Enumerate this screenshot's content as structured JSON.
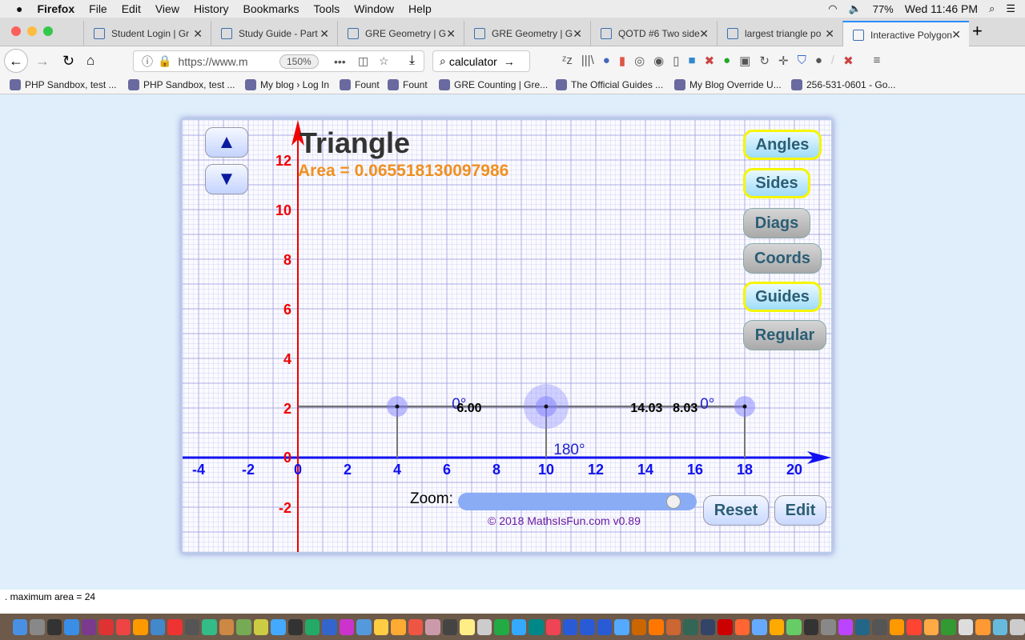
{
  "menubar": {
    "app": "Firefox",
    "items": [
      "File",
      "Edit",
      "View",
      "History",
      "Bookmarks",
      "Tools",
      "Window",
      "Help"
    ],
    "battery": "77%",
    "clock": "Wed 11:46 PM"
  },
  "tabs": [
    {
      "label": "Student Login | Gr"
    },
    {
      "label": "Study Guide - Part"
    },
    {
      "label": "GRE Geometry | G"
    },
    {
      "label": "GRE Geometry | G"
    },
    {
      "label": "QOTD #6 Two side"
    },
    {
      "label": "largest triangle po"
    },
    {
      "label": "Interactive Polygon",
      "active": true
    }
  ],
  "nav": {
    "url": "https://www.m",
    "zoom": "150%",
    "search": "calculator"
  },
  "bookmarks": [
    "PHP Sandbox, test ...",
    "PHP Sandbox, test ...",
    "My blog › Log In",
    "Fount",
    "Fount",
    "GRE Counting | Gre...",
    "The Official Guides ...",
    "My Blog Override U...",
    "256-531-0601 - Go..."
  ],
  "app": {
    "title": "Triangle",
    "area": "Area = 0.065518130097986",
    "buttons": [
      {
        "label": "Angles",
        "state": "on"
      },
      {
        "label": "Sides",
        "state": "on"
      },
      {
        "label": "Diags",
        "state": "off"
      },
      {
        "label": "Coords",
        "state": "off"
      },
      {
        "label": "Guides",
        "state": "on"
      },
      {
        "label": "Regular",
        "state": "off"
      }
    ],
    "up": "▲",
    "down": "▼",
    "zoom_label": "Zoom:",
    "zoom_value": 0.5,
    "reset": "Reset",
    "edit": "Edit",
    "copyright": "© 2018 MathsIsFun.com v0.89",
    "x_ticks": [
      -4,
      -2,
      0,
      2,
      4,
      6,
      8,
      10,
      12,
      14,
      16,
      18,
      20
    ],
    "y_ticks": [
      -2,
      2,
      4,
      6,
      8,
      10,
      12
    ],
    "y_zero": "0",
    "vertices": [
      [
        4,
        2.06
      ],
      [
        10,
        2.06
      ],
      [
        18,
        2.06
      ]
    ],
    "side_labels": [
      {
        "text": "6.00",
        "x": 6.4,
        "y": 2.06
      },
      {
        "text": "14.03",
        "x": 13.4,
        "y": 2.06
      },
      {
        "text": "8.03",
        "x": 15.1,
        "y": 2.06
      }
    ],
    "angle_labels": [
      {
        "text": "0°",
        "x": 6.2,
        "y": 2.2
      },
      {
        "text": "180°",
        "x": 10.3,
        "y": 0.35
      },
      {
        "text": "0°",
        "x": 16.2,
        "y": 2.2
      }
    ],
    "colors": {
      "x_axis": "#1010f0",
      "y_axis": "#f00000",
      "area": "#f09020",
      "grid": "#9a9ae0"
    }
  },
  "status": ". maximum area = 24"
}
